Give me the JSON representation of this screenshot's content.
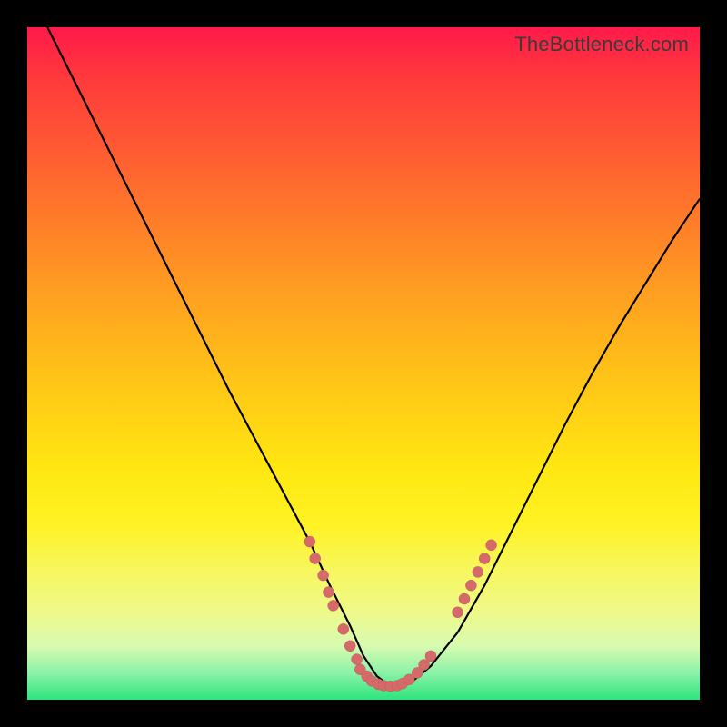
{
  "watermark": "TheBottleneck.com",
  "chart_data": {
    "type": "line",
    "title": "",
    "xlabel": "",
    "ylabel": "",
    "xlim": [
      0,
      100
    ],
    "ylim": [
      0,
      100
    ],
    "series": [
      {
        "name": "bottleneck-curve",
        "x": [
          3,
          6,
          10,
          14,
          18,
          22,
          26,
          30,
          34,
          38,
          42,
          45,
          48,
          50,
          52,
          54,
          57,
          60,
          64,
          68,
          72,
          76,
          80,
          84,
          88,
          92,
          96,
          100
        ],
        "y": [
          100,
          94,
          86,
          78,
          70,
          62,
          54,
          46,
          38.5,
          31,
          23.5,
          17,
          11,
          6.5,
          3.5,
          2,
          2.5,
          5,
          10,
          17,
          25,
          33,
          41,
          48.5,
          55.5,
          62,
          68.5,
          74.5
        ]
      }
    ],
    "markers": {
      "name": "highlight-dots",
      "points": [
        {
          "x": 42,
          "y": 23.5
        },
        {
          "x": 42.8,
          "y": 21
        },
        {
          "x": 44,
          "y": 18.5
        },
        {
          "x": 44.8,
          "y": 16
        },
        {
          "x": 45.5,
          "y": 14
        },
        {
          "x": 47,
          "y": 10.5
        },
        {
          "x": 48,
          "y": 8
        },
        {
          "x": 49,
          "y": 6
        },
        {
          "x": 49.5,
          "y": 4.5
        },
        {
          "x": 50.5,
          "y": 3.5
        },
        {
          "x": 51.2,
          "y": 2.8
        },
        {
          "x": 52.2,
          "y": 2.3
        },
        {
          "x": 53,
          "y": 2.1
        },
        {
          "x": 54,
          "y": 2.0
        },
        {
          "x": 55,
          "y": 2.1
        },
        {
          "x": 55.8,
          "y": 2.4
        },
        {
          "x": 56.8,
          "y": 3
        },
        {
          "x": 58,
          "y": 4
        },
        {
          "x": 59,
          "y": 5.2
        },
        {
          "x": 60,
          "y": 6.5
        },
        {
          "x": 64,
          "y": 13
        },
        {
          "x": 65,
          "y": 15
        },
        {
          "x": 66,
          "y": 17
        },
        {
          "x": 67,
          "y": 19
        },
        {
          "x": 68,
          "y": 21
        },
        {
          "x": 69,
          "y": 23
        }
      ]
    }
  }
}
